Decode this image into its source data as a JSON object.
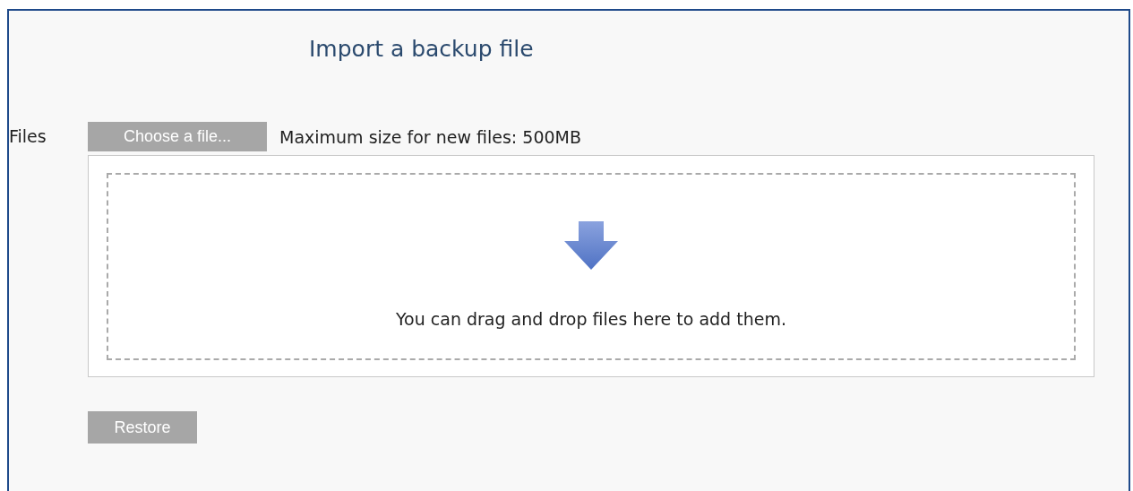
{
  "heading": "Import a backup file",
  "files_label": "Files",
  "choose_button": "Choose a file...",
  "max_size": "Maximum size for new files: 500MB",
  "drop_hint": "You can drag and drop files here to add them.",
  "restore_button": "Restore"
}
